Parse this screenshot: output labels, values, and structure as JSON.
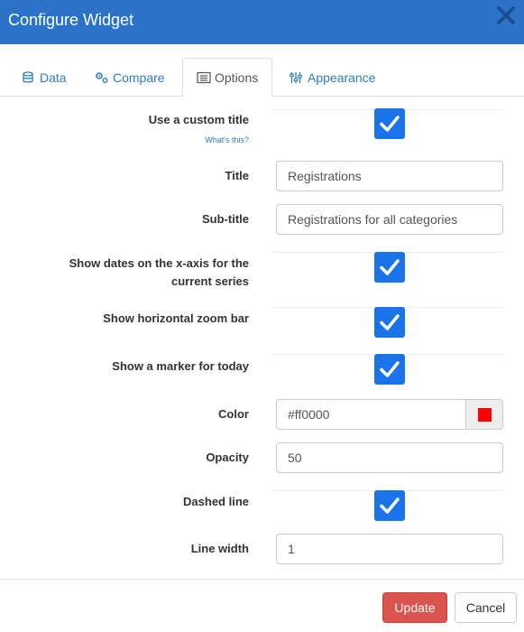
{
  "dialog": {
    "title": "Configure Widget",
    "close_icon": "close-icon"
  },
  "tabs": [
    {
      "label": "Data",
      "icon": "database-icon",
      "active": false
    },
    {
      "label": "Compare",
      "icon": "gears-icon",
      "active": false
    },
    {
      "label": "Options",
      "icon": "list-icon",
      "active": true
    },
    {
      "label": "Appearance",
      "icon": "sliders-icon",
      "active": false
    }
  ],
  "options": {
    "custom_title": {
      "label": "Use a custom title",
      "help_link": "What's this?",
      "checked": true
    },
    "title": {
      "label": "Title",
      "value": "Registrations"
    },
    "subtitle": {
      "label": "Sub-title",
      "value": "Registrations for all categories"
    },
    "show_dates": {
      "label_line1": "Show dates on the x-axis for the",
      "label_line2": "current series",
      "checked": true
    },
    "zoom_bar": {
      "label": "Show horizontal zoom bar",
      "checked": true
    },
    "today_marker": {
      "label": "Show a marker for today",
      "checked": true
    },
    "color": {
      "label": "Color",
      "value": "#ff0000",
      "swatch_color": "#ff0000"
    },
    "opacity": {
      "label": "Opacity",
      "value": "50"
    },
    "dashed_line": {
      "label": "Dashed line",
      "checked": true
    },
    "line_width": {
      "label": "Line width",
      "value": "1"
    }
  },
  "footer": {
    "update_label": "Update",
    "cancel_label": "Cancel"
  },
  "colors": {
    "header_bg": "#2b73c9",
    "link": "#2f7cc4",
    "checkbox": "#1a73e8",
    "update_button": "#d9534f"
  }
}
